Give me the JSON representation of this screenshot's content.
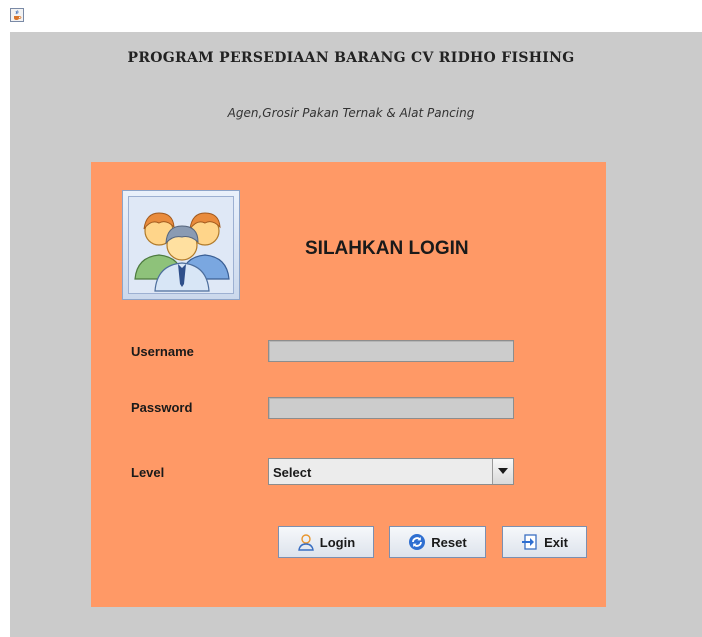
{
  "window": {
    "app_icon": "java-cup-icon"
  },
  "header": {
    "title": "PROGRAM PERSEDIAAN BARANG CV RIDHO FISHING",
    "subtitle": "Agen,Grosir Pakan Ternak & Alat Pancing"
  },
  "login": {
    "heading": "SILAHKAN LOGIN",
    "avatar_icon": "users-group-icon",
    "username": {
      "label": "Username",
      "value": ""
    },
    "password": {
      "label": "Password",
      "value": ""
    },
    "level": {
      "label": "Level",
      "selected": "Select"
    },
    "buttons": {
      "login": {
        "label": "Login",
        "icon": "user-icon"
      },
      "reset": {
        "label": "Reset",
        "icon": "refresh-icon"
      },
      "exit": {
        "label": "Exit",
        "icon": "exit-icon"
      }
    }
  },
  "colors": {
    "background": "#cbcbcb",
    "panel": "#ff9966",
    "field": "#cccccc"
  }
}
